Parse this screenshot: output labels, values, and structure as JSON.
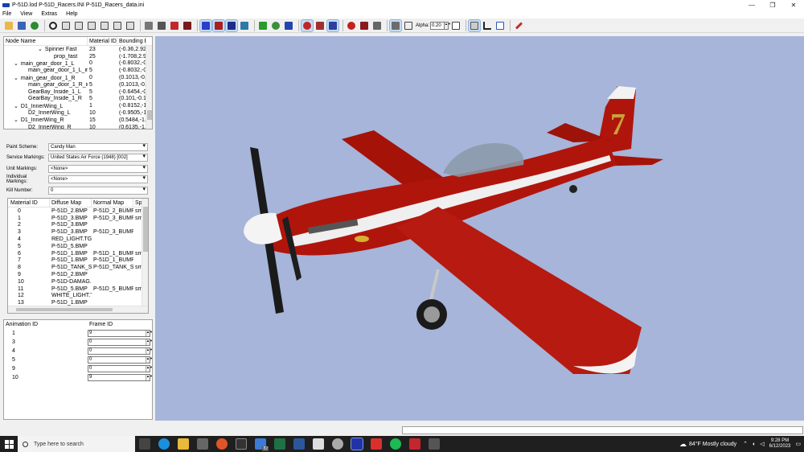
{
  "window": {
    "title": "P-51D.lod  P-51D_Racers.INI  P-51D_Racers_data.ini",
    "min": "—",
    "max": "❐",
    "close": "✕"
  },
  "menu": [
    "File",
    "View",
    "Extras",
    "Help"
  ],
  "toolbar": {
    "alpha_label": "Alpha:",
    "alpha_value": "0.20"
  },
  "node_tree": {
    "headers": [
      "Node Name",
      "Material ID",
      "Bounding Bo"
    ],
    "rows": [
      {
        "tog": "⌄",
        "name": "Spinner Fast",
        "mat": "23",
        "bb": "(-0.36,2.922,"
      },
      {
        "tog": "",
        "name": "prop_fast",
        "mat": "25",
        "bb": "(-1.708,2.984"
      },
      {
        "tog": "⌄",
        "name": "main_gear_door_1_L",
        "mat": "0",
        "bb": "(-0.8032,-0.1"
      },
      {
        "tog": "",
        "name": "main_gear_door_1_L_in...",
        "mat": "5",
        "bb": "(-0.8032,-0.1"
      },
      {
        "tog": "⌄",
        "name": "main_gear_door_1_R",
        "mat": "0",
        "bb": "(0.1013,-0.14"
      },
      {
        "tog": "",
        "name": "main_gear_door_1_R_in...",
        "mat": "5",
        "bb": "(0.1013,-0.14"
      },
      {
        "tog": "",
        "name": "GearBay_Inside_1_L",
        "mat": "5",
        "bb": "(-0.6454,-0.1"
      },
      {
        "tog": "",
        "name": "GearBay_Inside_1_R",
        "mat": "5",
        "bb": "(0.101,-0.144"
      },
      {
        "tog": "⌄",
        "name": "D1_InnerWing_L",
        "mat": "1",
        "bb": "(-0.8152,-1.2"
      },
      {
        "tog": "",
        "name": "D2_InnerWing_L",
        "mat": "10",
        "bb": "(-0.9505,-1.2"
      },
      {
        "tog": "⌄",
        "name": "D1_InnerWing_R",
        "mat": "15",
        "bb": "(0.5484,-1.29"
      },
      {
        "tog": "",
        "name": "D2_InnerWing_R",
        "mat": "10",
        "bb": "(0.6135,-1.29"
      }
    ]
  },
  "settings": [
    {
      "label": "Paint Scheme:",
      "value": "Candy Man"
    },
    {
      "label": "Service Markings:",
      "value": "United States Air Force (1948) [002]"
    },
    {
      "label": "Unit Markings:",
      "value": "<None>"
    },
    {
      "label": "Individual Markings:",
      "value": "<None>"
    },
    {
      "label": "Kill Number:",
      "value": "0"
    }
  ],
  "materials": {
    "headers": [
      "Material ID",
      "Diffuse Map",
      "Normal Map",
      "Spe"
    ],
    "rows": [
      [
        "0",
        "P-51D_2.BMP",
        "P-51D_2_BUMP....",
        "sm"
      ],
      [
        "1",
        "P-51D_3.BMP",
        "P-51D_3_BUMP....",
        "sm"
      ],
      [
        "2",
        "P-51D_3.BMP",
        "",
        ""
      ],
      [
        "3",
        "P-51D_3.BMP",
        "P-51D_3_BUMP....",
        ""
      ],
      [
        "4",
        "RED_LIGHT.TGA",
        "",
        ""
      ],
      [
        "5",
        "P-51D_5.BMP",
        "",
        ""
      ],
      [
        "6",
        "P-51D_1.BMP",
        "P-51D_1_BUMP....",
        "sm"
      ],
      [
        "7",
        "P-51D_1.BMP",
        "P-51D_1_BUMP....",
        ""
      ],
      [
        "8",
        "P-51D_TANK_S...",
        "P-51D_TANK_S...",
        "sm"
      ],
      [
        "9",
        "P-51D_2.BMP",
        "",
        ""
      ],
      [
        "10",
        "P-51D-DAMAG...",
        "",
        ""
      ],
      [
        "11",
        "P-51D_5.BMP",
        "P-51D_5_BUMP....",
        "sm"
      ],
      [
        "12",
        "WHITE_LIGHT.T...",
        "",
        ""
      ],
      [
        "13",
        "P-51D_1.BMP",
        "",
        ""
      ]
    ]
  },
  "animations": {
    "headers": [
      "Animation ID",
      "Frame ID"
    ],
    "rows": [
      {
        "id": "1",
        "frame": "9"
      },
      {
        "id": "3",
        "frame": "0"
      },
      {
        "id": "4",
        "frame": "0"
      },
      {
        "id": "5",
        "frame": "0"
      },
      {
        "id": "9",
        "frame": "0"
      },
      {
        "id": "10",
        "frame": "9"
      }
    ]
  },
  "taskbar": {
    "search_placeholder": "Type here to search",
    "weather": "84°F  Mostly cloudy",
    "time": "9:28 PM",
    "date": "6/12/2023",
    "mail_badge": "82"
  },
  "colors": {
    "viewport_bg": "#a6b5d9",
    "plane_red": "#b0150c",
    "taskbar": "#1f1f1f"
  }
}
